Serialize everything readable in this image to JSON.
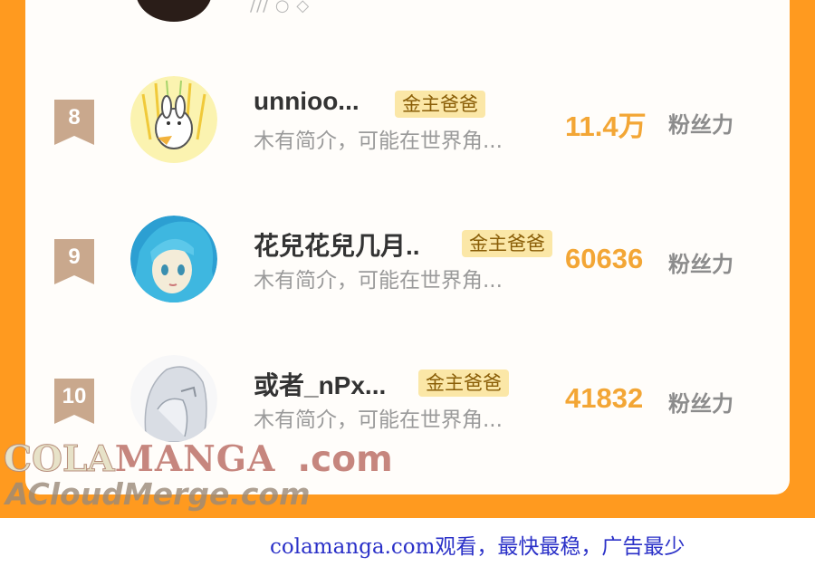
{
  "colors": {
    "frame": "#ff9a1f",
    "accent_number": "#f3a635",
    "badge_bg": "#fbe7a7",
    "rank_badge": "#c9a88d",
    "footer_link": "#2b31c8"
  },
  "top_partial": {
    "icons": "avatar, partial-action-icons"
  },
  "fans": [
    {
      "rank": "8",
      "name": "unnioo...",
      "badge": "金主爸爸",
      "bio": "木有简介，可能在世界角...",
      "count": "11.4万",
      "unit": "粉丝力",
      "avatar_icon": "bunny-avatar-icon"
    },
    {
      "rank": "9",
      "name": "花兒花兒几月..",
      "badge": "金主爸爸",
      "bio": "木有简介，可能在世界角...",
      "count": "60636",
      "unit": "粉丝力",
      "avatar_icon": "anime-girl-avatar-icon"
    },
    {
      "rank": "10",
      "name": "或者_nPx...",
      "badge": "金主爸爸",
      "bio": "木有简介，可能在世界角...",
      "count": "41832",
      "unit": "粉丝力",
      "avatar_icon": "sketch-avatar-icon"
    }
  ],
  "watermark": {
    "cola": "COLA",
    "manga": "MANGA",
    "com": ".com",
    "cloud": "ACloudMerge.com"
  },
  "footer": {
    "text": "colamanga.com观看，最快最稳，广告最少"
  }
}
